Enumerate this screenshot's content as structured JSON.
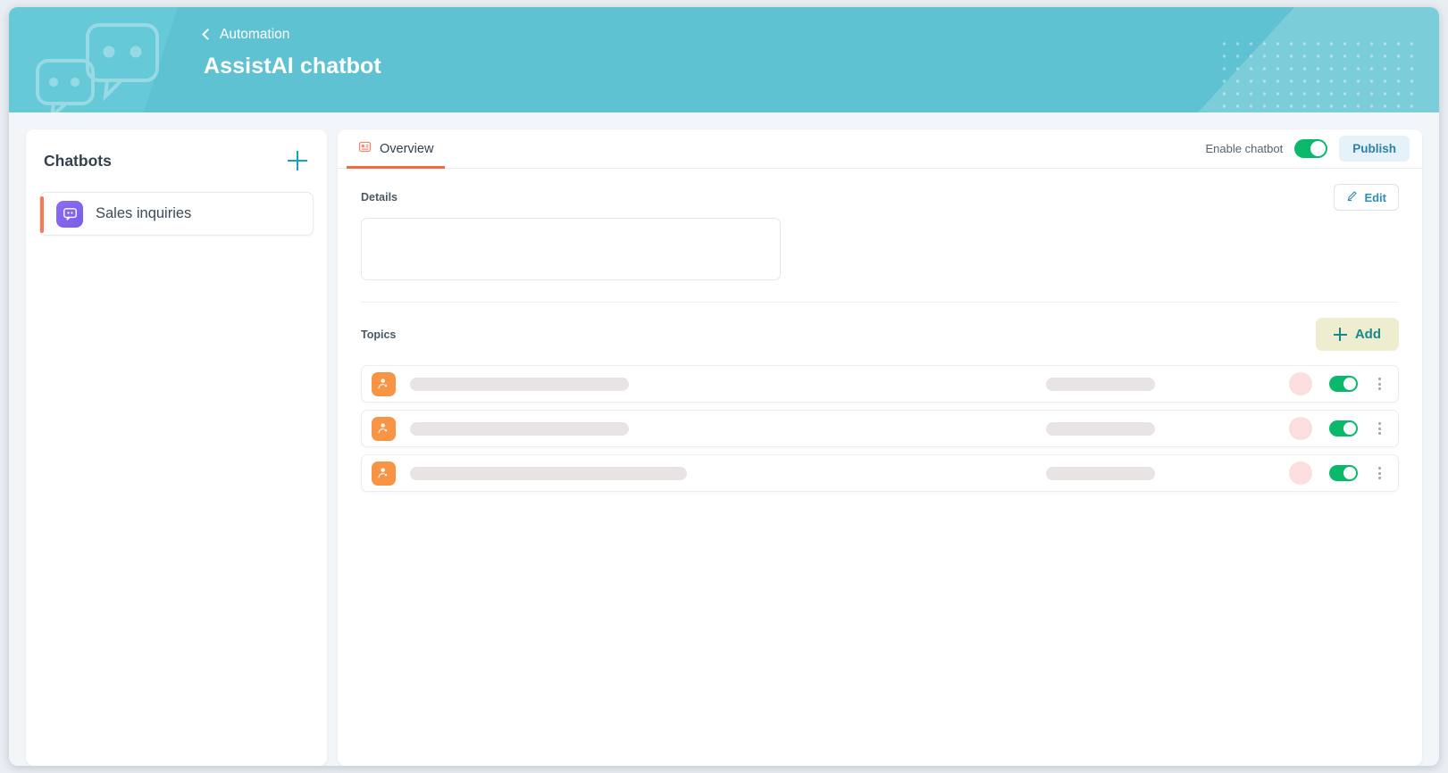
{
  "header": {
    "back_icon": "chevron-left-icon",
    "breadcrumb": "Automation",
    "title": "AssistAI chatbot",
    "watermark_icon": "chat-bubbles-watermark",
    "bg_color": "#5ec2d2"
  },
  "sidebar": {
    "title": "Chatbots",
    "add_icon": "plus-icon",
    "items": [
      {
        "label": "Sales inquiries",
        "icon": "chat-bubble-icon",
        "selected": true,
        "accent_color": "#f47b53",
        "icon_color": "#7b5bea"
      }
    ]
  },
  "main": {
    "tabs": [
      {
        "label": "Overview",
        "icon": "overview-card-icon",
        "active": true,
        "icon_color": "#f4693f"
      }
    ],
    "enable_chatbot_label": "Enable chatbot",
    "enable_chatbot_on": true,
    "publish_label": "Publish",
    "publish_color": "#2f7fa8",
    "details": {
      "label": "Details",
      "value": "",
      "placeholder": "",
      "edit_label": "Edit",
      "edit_icon": "pencil-icon"
    },
    "topics": {
      "label": "Topics",
      "add_label": "Add",
      "add_icon": "plus-icon",
      "add_bg_color": "#eeedcf",
      "add_text_color": "#18888f",
      "rows": [
        {
          "icon": "user-topic-icon",
          "skeleton_width": 245,
          "right_skeleton": true,
          "avatar_color": "#fcdede",
          "enabled": true,
          "menu_icon": "kebab-menu-icon"
        },
        {
          "icon": "user-topic-icon",
          "skeleton_width": 245,
          "right_skeleton": true,
          "avatar_color": "#fcdede",
          "enabled": true,
          "menu_icon": "kebab-menu-icon"
        },
        {
          "icon": "user-topic-icon",
          "skeleton_width": 310,
          "right_skeleton": true,
          "avatar_color": "#fcdede",
          "enabled": true,
          "menu_icon": "kebab-menu-icon"
        }
      ]
    }
  }
}
